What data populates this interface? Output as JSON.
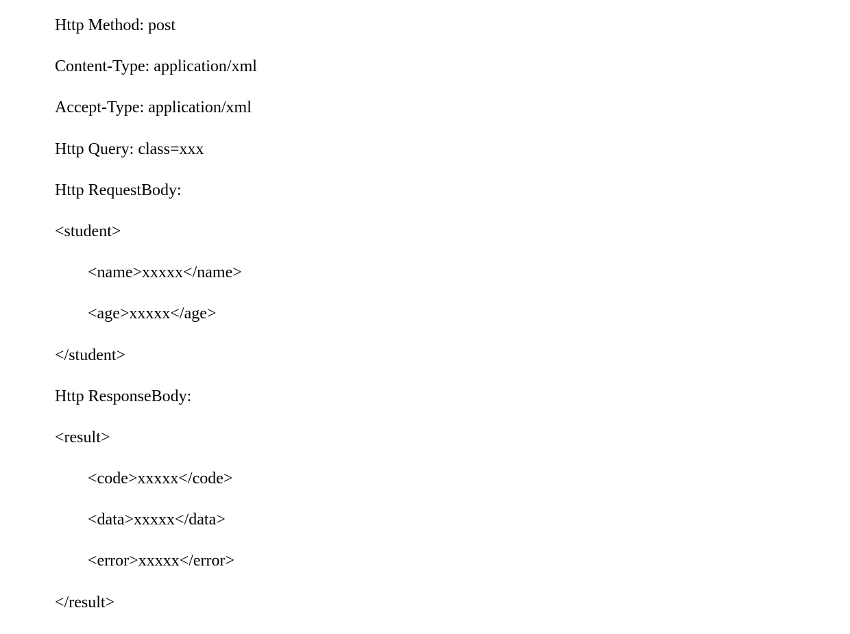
{
  "lines": {
    "l1": "Http Method: post",
    "l2": "Content-Type: application/xml",
    "l3": "Accept-Type: application/xml",
    "l4": "Http Query: class=xxx",
    "l5": "Http RequestBody:",
    "l6": "<student>",
    "l7": "<name>xxxxx</name>",
    "l8": "<age>xxxxx</age>",
    "l9": "</student>",
    "l10": "Http ResponseBody:",
    "l11": "<result>",
    "l12": "<code>xxxxx</code>",
    "l13": "<data>xxxxx</data>",
    "l14": "<error>xxxxx</error>",
    "l15": "</result>"
  }
}
